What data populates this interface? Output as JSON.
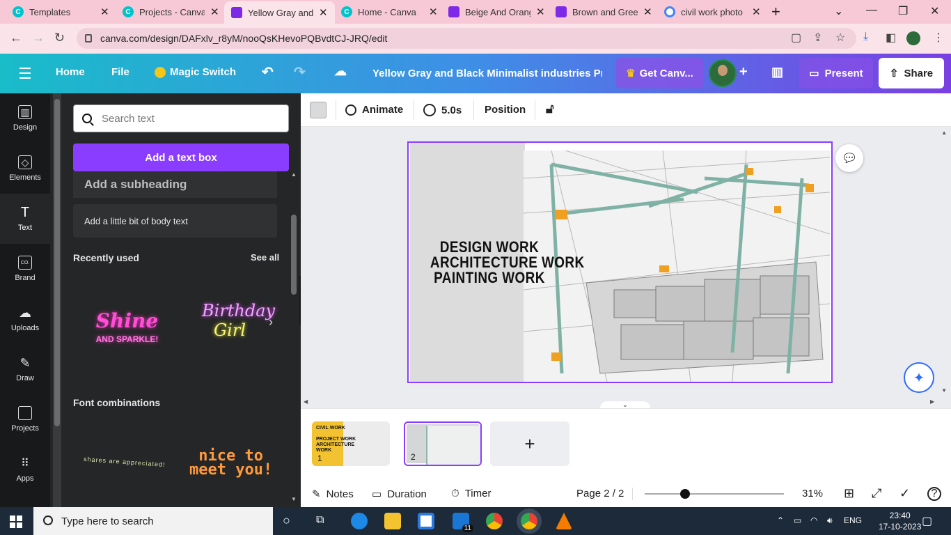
{
  "browser": {
    "tabs": [
      {
        "title": "Templates",
        "icon": "canva-favicon"
      },
      {
        "title": "Projects - Canva",
        "icon": "canva-favicon"
      },
      {
        "title": "Yellow Gray and",
        "icon": "canva-heart-favicon",
        "active": true
      },
      {
        "title": "Home - Canva",
        "icon": "canva-favicon"
      },
      {
        "title": "Beige And Orang",
        "icon": "canva-heart-favicon"
      },
      {
        "title": "Brown and Gree",
        "icon": "canva-heart-favicon"
      },
      {
        "title": "civil work photo",
        "icon": "google-favicon"
      }
    ],
    "url": "canva.com/design/DAFxlv_r8yM/nooQsKHevoPQBvdtCJ-JRQ/edit"
  },
  "header": {
    "home": "Home",
    "file": "File",
    "magic_switch": "Magic Switch",
    "doc_title": "Yellow Gray and Black Minimalist industries Pr...",
    "get_canva": "Get Canv...",
    "present": "Present",
    "share": "Share"
  },
  "rail": [
    {
      "label": "Design",
      "icon": "design-icon"
    },
    {
      "label": "Elements",
      "icon": "elements-icon"
    },
    {
      "label": "Text",
      "icon": "text-icon",
      "active": true
    },
    {
      "label": "Brand",
      "icon": "brand-icon"
    },
    {
      "label": "Uploads",
      "icon": "uploads-icon"
    },
    {
      "label": "Draw",
      "icon": "draw-icon"
    },
    {
      "label": "Projects",
      "icon": "projects-icon"
    },
    {
      "label": "Apps",
      "icon": "apps-icon"
    }
  ],
  "panel": {
    "search_placeholder": "Search text",
    "add_text_box": "Add a text box",
    "add_subheading": "Add a subheading",
    "add_body": "Add a little bit of body text",
    "recently_used": "Recently used",
    "see_all": "See all",
    "font_combinations": "Font combinations",
    "sample_shine": "Shine",
    "sample_shine_sub": "AND SPARKLE!",
    "sample_birthday": "Birthday",
    "sample_girl": "Girl",
    "sample_combo1": "shares are appreciated!",
    "sample_combo2_line1": "nice to",
    "sample_combo2_line2": "meet you!"
  },
  "toolbar": {
    "animate": "Animate",
    "duration": "5.0s",
    "position": "Position"
  },
  "slide": {
    "lines": [
      "DESIGN WORK",
      "ARCHITECTURE WORK",
      "PAINTING WORK"
    ]
  },
  "pages": {
    "thumb1_num": "1",
    "thumb1_title": "CIVIL WORK",
    "thumb1_sub": "PROJECT WORK ARCHITECTURE WORK",
    "thumb2_num": "2"
  },
  "bottom": {
    "notes": "Notes",
    "duration": "Duration",
    "timer": "Timer",
    "page": "Page 2 / 2",
    "zoom": "31%",
    "zoom_level": 0.31
  },
  "taskbar": {
    "search_placeholder": "Type here to search",
    "mail_badge": "11",
    "lang": "ENG",
    "time": "23:40",
    "date": "17-10-2023"
  },
  "colors": {
    "canva_purple": "#8b3dff",
    "header_start": "#19bcc9",
    "header_end": "#7a3fe4",
    "panel_bg": "#252627",
    "rail_bg": "#18191b"
  }
}
